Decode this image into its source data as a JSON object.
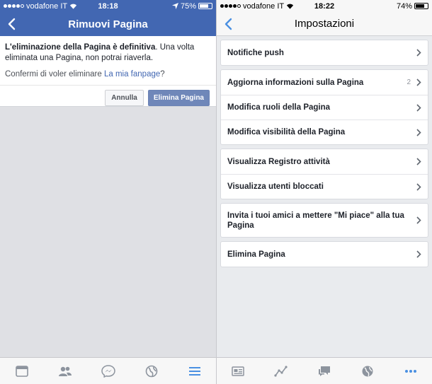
{
  "left": {
    "status": {
      "carrier": "vodafone IT",
      "time": "18:18",
      "battery": "75%",
      "battery_level": 0.75
    },
    "nav": {
      "title": "Rimuovi Pagina"
    },
    "dialog": {
      "msg_bold": "L'eliminazione della Pagina è definitiva",
      "msg_rest": ". Una volta eliminata una Pagina, non potrai riaverla.",
      "confirm_prefix": "Confermi di voler eliminare ",
      "page_name": "La mia fanpage",
      "confirm_suffix": "?",
      "cancel_label": "Annulla",
      "delete_label": "Elimina Pagina"
    },
    "tabs": [
      "news-feed-icon",
      "friends-icon",
      "messenger-icon",
      "notifications-globe-icon",
      "menu-icon"
    ]
  },
  "right": {
    "status": {
      "carrier": "vodafone IT",
      "time": "18:22",
      "battery": "74%",
      "battery_level": 0.74
    },
    "nav": {
      "title": "Impostazioni"
    },
    "groups": [
      {
        "rows": [
          {
            "label": "Notifiche push"
          }
        ]
      },
      {
        "rows": [
          {
            "label": "Aggiorna informazioni sulla Pagina",
            "badge": "2"
          },
          {
            "label": "Modifica ruoli della Pagina"
          },
          {
            "label": "Modifica visibilità della Pagina"
          }
        ]
      },
      {
        "rows": [
          {
            "label": "Visualizza Registro attività"
          },
          {
            "label": "Visualizza utenti bloccati"
          }
        ]
      },
      {
        "rows": [
          {
            "label": "Invita i tuoi amici a mettere \"Mi piace\" alla tua Pagina"
          }
        ]
      },
      {
        "rows": [
          {
            "label": "Elimina Pagina"
          }
        ]
      }
    ],
    "tabs": [
      "page-icon",
      "activity-chart-icon",
      "messages-icon",
      "notifications-globe-icon",
      "more-icon"
    ]
  },
  "colors": {
    "facebook_blue": "#4267b2",
    "delete_button": "#6f87b9",
    "active_tab": "#4a90e2"
  }
}
